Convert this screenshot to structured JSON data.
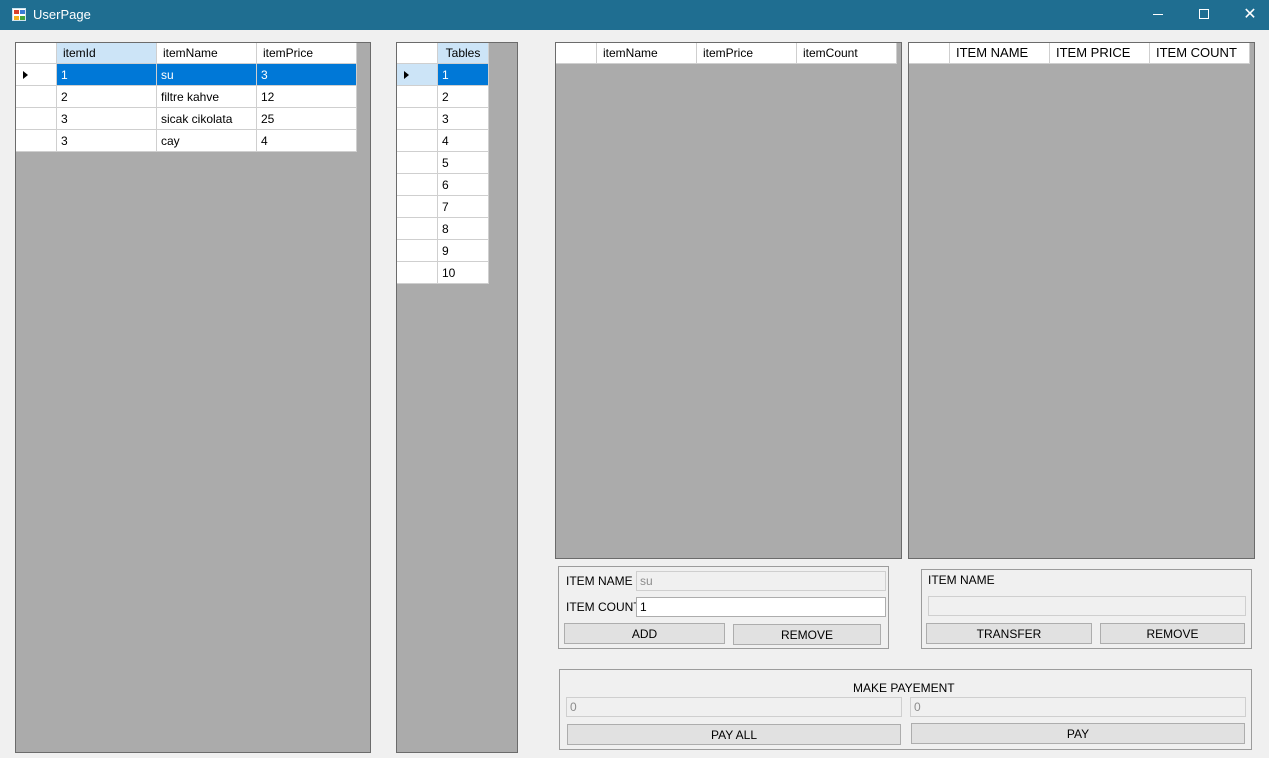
{
  "window": {
    "title": "UserPage"
  },
  "items_grid": {
    "columns": [
      "itemId",
      "itemName",
      "itemPrice"
    ],
    "rows": [
      [
        "1",
        "su",
        "3"
      ],
      [
        "2",
        "filtre kahve",
        "12"
      ],
      [
        "3",
        "sicak cikolata",
        "25"
      ],
      [
        "3",
        "cay",
        "4"
      ]
    ]
  },
  "tables_grid": {
    "column": "Tables",
    "rows": [
      "1",
      "2",
      "3",
      "4",
      "5",
      "6",
      "7",
      "8",
      "9",
      "10"
    ]
  },
  "order_grid": {
    "columns": [
      "itemName",
      "itemPrice",
      "itemCount"
    ]
  },
  "transfer_grid": {
    "columns": [
      "ITEM NAME",
      "ITEM PRICE",
      "ITEM COUNT"
    ]
  },
  "add_panel": {
    "item_name_label": "ITEM NAME",
    "item_name_value": "su",
    "item_count_label": "ITEM COUNT",
    "item_count_value": "1",
    "add_label": "ADD",
    "remove_label": "REMOVE"
  },
  "transfer_panel": {
    "item_name_label": "ITEM NAME",
    "item_name_value": "",
    "transfer_label": "TRANSFER",
    "remove_label": "REMOVE"
  },
  "payment_panel": {
    "title": "MAKE PAYEMENT",
    "left_value": "0",
    "right_value": "0",
    "pay_all_label": "PAY ALL",
    "pay_label": "PAY"
  },
  "colors": {
    "titlebar": "#1f6e91",
    "grid_background": "#ababab",
    "selection": "#0078d7",
    "selected_header": "#cce4f7"
  },
  "icons": [
    "app-icon",
    "minimize-icon",
    "maximize-icon",
    "close-icon",
    "current-row-icon"
  ]
}
